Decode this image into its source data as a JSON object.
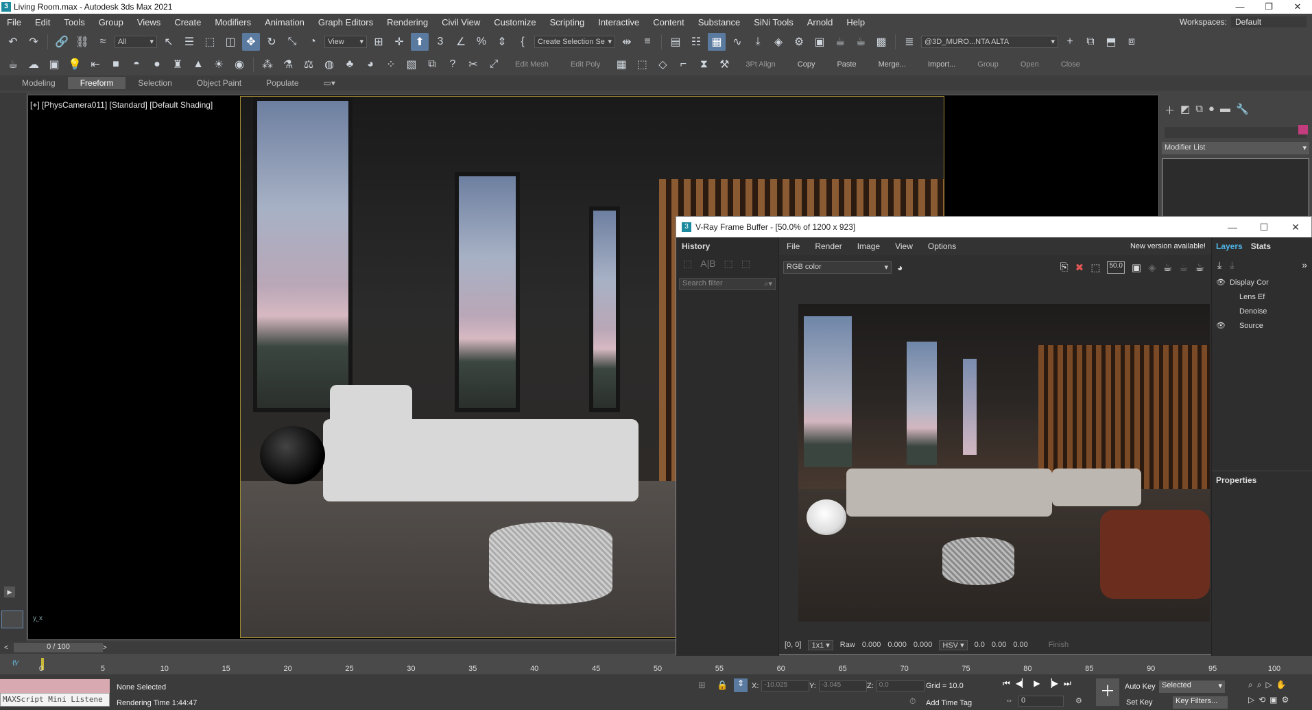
{
  "window": {
    "title": "Living Room.max - Autodesk 3ds Max 2021",
    "controls": [
      "—",
      "❐",
      "✕"
    ]
  },
  "menu": {
    "items": [
      "File",
      "Edit",
      "Tools",
      "Group",
      "Views",
      "Create",
      "Modifiers",
      "Animation",
      "Graph Editors",
      "Rendering",
      "Civil View",
      "Customize",
      "Scripting",
      "Interactive",
      "Content",
      "Substance",
      "SiNi Tools",
      "Arnold",
      "Help"
    ],
    "workspaces_label": "Workspaces:",
    "workspaces_value": "Default"
  },
  "toolbar": {
    "filter_value": "All",
    "ref_coord_value": "View",
    "selection_set_placeholder": "Create Selection Se",
    "layer_value": "@3D_MURO...NTA ALTA"
  },
  "toolbar2": {
    "labels": [
      "Edit Mesh",
      "Edit Poly",
      "3Pt Align",
      "Copy",
      "Paste",
      "Merge...",
      "Import...",
      "Group",
      "Open",
      "Close"
    ]
  },
  "ribbon": {
    "tabs": [
      "Modeling",
      "Freeform",
      "Selection",
      "Object Paint",
      "Populate"
    ],
    "active": "Freeform"
  },
  "viewport": {
    "label": "[+] [PhysCamera011] [Standard] [Default Shading]"
  },
  "command_panel": {
    "modifier_list_label": "Modifier List",
    "accent_color": "#c33d7e"
  },
  "vfb": {
    "title": "V-Ray Frame Buffer - [50.0% of 1200 x 923]",
    "history_label": "History",
    "search_placeholder": "Search filter",
    "menu": [
      "File",
      "Render",
      "Image",
      "View",
      "Options"
    ],
    "new_version": "New version available!",
    "channel_value": "RGB color",
    "zoom_badge": "50.0",
    "status": {
      "coords": "[0, 0]",
      "ratio": "1x1",
      "raw_label": "Raw",
      "r": "0.000",
      "g": "0.000",
      "b": "0.000",
      "mode": "HSV",
      "h": "0.0",
      "s": "0.00",
      "v": "0.00",
      "finish": "Finish"
    },
    "layers_tabs": [
      "Layers",
      "Stats"
    ],
    "layers": [
      "Display Cor",
      "Lens Ef",
      "Denoise",
      "Source"
    ],
    "properties_label": "Properties"
  },
  "timeline": {
    "slider_label": "0 / 100",
    "ticks": [
      "0",
      "5",
      "10",
      "15",
      "20",
      "25",
      "30",
      "35",
      "40",
      "45",
      "50",
      "55",
      "60",
      "65",
      "70",
      "75",
      "80",
      "85",
      "90",
      "95",
      "100"
    ]
  },
  "status": {
    "maxscript_label": "MAXScript Mini Listene",
    "selection": "None Selected",
    "render_time": "Rendering Time  1:44:47",
    "x_label": "X:",
    "x_value": "-10.025",
    "y_label": "Y:",
    "y_value": "-3.045",
    "z_label": "Z:",
    "z_value": "0.0",
    "grid": "Grid = 10.0",
    "add_time_tag": "Add Time Tag",
    "auto_key": "Auto Key",
    "auto_key_value": "Selected",
    "set_key": "Set Key",
    "key_filters": "Key Filters...",
    "frame_value": "0"
  }
}
